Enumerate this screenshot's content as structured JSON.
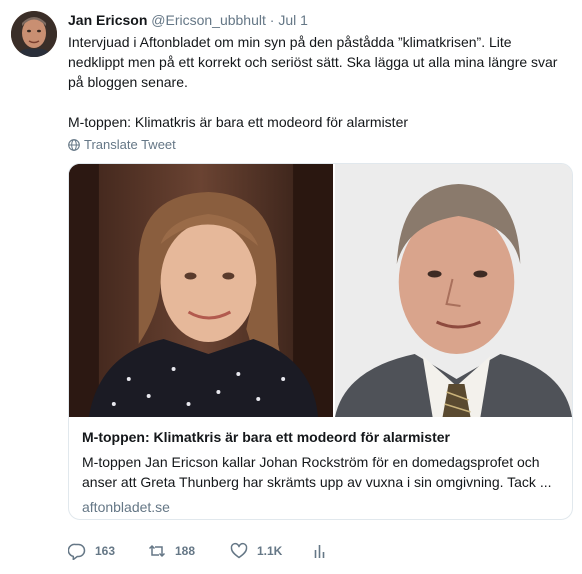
{
  "tweet": {
    "display_name": "Jan Ericson",
    "handle": "@Ericson_ubbhult",
    "separator": "·",
    "date": "Jul 1",
    "text_line1": "Intervjuad i Aftonbladet om min syn på den påstådda ”klimatkrisen”. Lite nedklippt men på ett korrekt och seriöst sätt. Ska lägga ut alla mina längre svar på bloggen senare.",
    "text_line2": "M-toppen: Klimatkris är bara ett modeord för alarmister",
    "translate_label": "Translate Tweet"
  },
  "card": {
    "title": "M-toppen: Klimatkris är bara ett modeord för alarmister",
    "description": "M-toppen Jan Ericson kallar Johan Rockström för en domedagsprofet och anser att Greta Thunberg har skrämts upp av vuxna i sin omgivning. Tack ...",
    "domain": "aftonbladet.se"
  },
  "actions": {
    "replies": "163",
    "retweets": "188",
    "likes": "1.1K"
  },
  "icons": {
    "avatar": "avatar-photo",
    "translate": "globe-icon",
    "reply": "reply-icon",
    "retweet": "retweet-icon",
    "like": "heart-icon",
    "analytics": "analytics-icon"
  },
  "colors": {
    "text": "#14171a",
    "secondary": "#657786",
    "border": "#e1e8ed"
  }
}
